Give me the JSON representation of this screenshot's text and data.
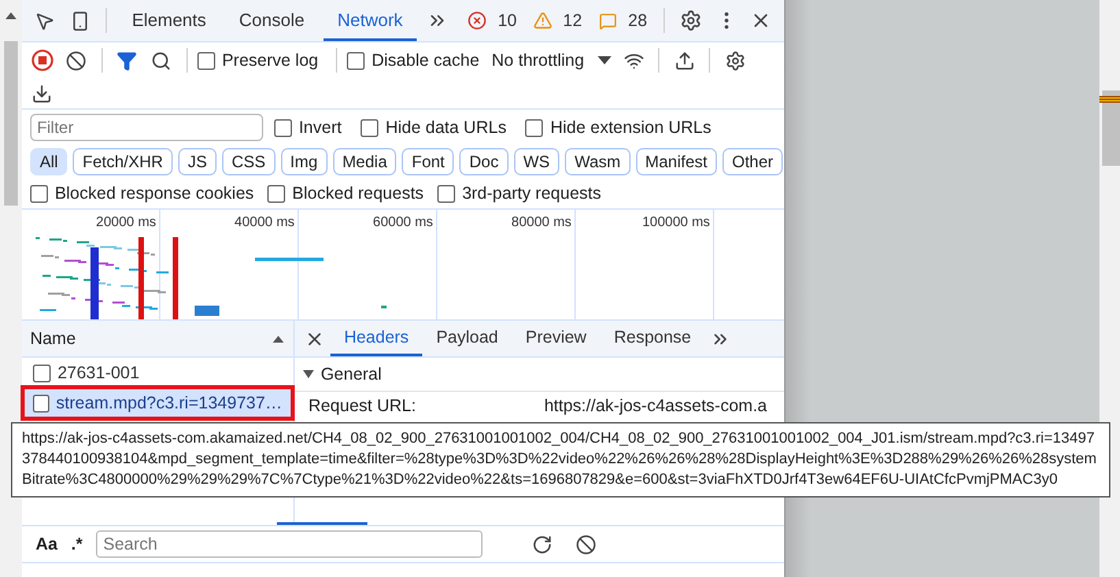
{
  "main_tabs": [
    {
      "label": "Elements",
      "selected": false
    },
    {
      "label": "Console",
      "selected": false
    },
    {
      "label": "Network",
      "selected": true
    }
  ],
  "issues": {
    "errors": "10",
    "warnings": "12",
    "info": "28"
  },
  "toolbar": {
    "recording": true,
    "preserve_log": {
      "label": "Preserve log",
      "checked": false
    },
    "disable_cache": {
      "label": "Disable cache",
      "checked": false
    },
    "throttling": "No throttling"
  },
  "filter": {
    "placeholder": "Filter"
  },
  "filter_options": [
    {
      "label": "Invert",
      "checked": false
    },
    {
      "label": "Hide data URLs",
      "checked": false
    },
    {
      "label": "Hide extension URLs",
      "checked": false
    }
  ],
  "type_filters": [
    {
      "label": "All",
      "selected": true
    },
    {
      "label": "Fetch/XHR",
      "selected": false
    },
    {
      "label": "JS",
      "selected": false
    },
    {
      "label": "CSS",
      "selected": false
    },
    {
      "label": "Img",
      "selected": false
    },
    {
      "label": "Media",
      "selected": false
    },
    {
      "label": "Font",
      "selected": false
    },
    {
      "label": "Doc",
      "selected": false
    },
    {
      "label": "WS",
      "selected": false
    },
    {
      "label": "Wasm",
      "selected": false
    },
    {
      "label": "Manifest",
      "selected": false
    },
    {
      "label": "Other",
      "selected": false
    }
  ],
  "block_options": [
    {
      "label": "Blocked response cookies",
      "checked": false
    },
    {
      "label": "Blocked requests",
      "checked": false
    },
    {
      "label": "3rd-party requests",
      "checked": false
    }
  ],
  "overview": {
    "ticks": [
      "20000 ms",
      "40000 ms",
      "60000 ms",
      "80000 ms",
      "100000 ms"
    ]
  },
  "requests": {
    "column": "Name",
    "rows": [
      {
        "name": "27631-001",
        "selected": false,
        "highlighted": false
      },
      {
        "name": "stream.mpd?c3.ri=1349737…",
        "selected": true,
        "highlighted": true
      }
    ]
  },
  "detail_tabs": [
    {
      "label": "Headers",
      "selected": true
    },
    {
      "label": "Payload",
      "selected": false
    },
    {
      "label": "Preview",
      "selected": false
    },
    {
      "label": "Response",
      "selected": false
    }
  ],
  "general": {
    "title": "General",
    "expanded": true,
    "rows": [
      {
        "label": "Request URL:",
        "value": "https://ak-jos-c4assets-com.a"
      }
    ]
  },
  "tooltip": "https://ak-jos-c4assets-com.akamaized.net/CH4_08_02_900_27631001001002_004/CH4_08_02_900_27631001001002_004_J01.ism/stream.mpd?c3.ri=13497378440100938104&mpd_segment_template=time&filter=%28type%3D%3D%22video%22%26%26%28%28DisplayHeight%3E%3D288%29%26%26%28systemBitrate%3C4800000%29%29%29%7C%7Ctype%21%3D%22video%22&ts=1696807829&e=600&st=3viaFhXTD0Jrf4T3ew64EF6U-UIAtCfcPvmjPMAC3y0",
  "search": {
    "case_label": "Aa",
    "regex_label": ".*",
    "placeholder": "Search"
  }
}
